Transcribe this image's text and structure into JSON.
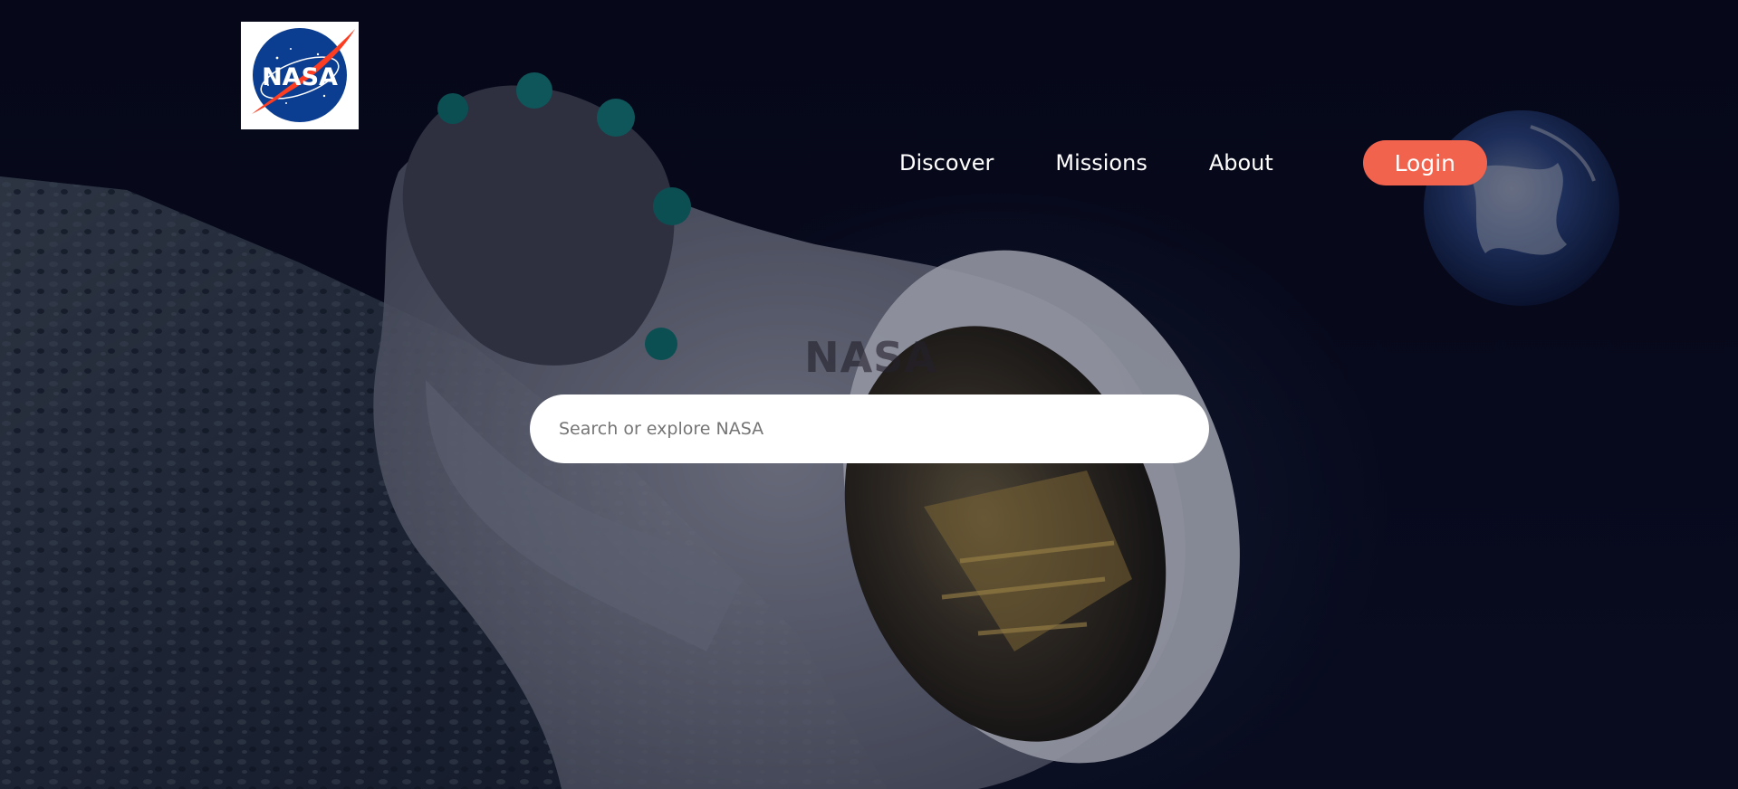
{
  "header": {
    "logo": {
      "icon": "nasa-meatball-logo",
      "text": "NASA"
    }
  },
  "nav": {
    "items": [
      {
        "label": "Discover"
      },
      {
        "label": "Missions"
      },
      {
        "label": "About"
      }
    ],
    "login_label": "Login"
  },
  "hero": {
    "heading": "NASA",
    "background": "astronaut-on-moon-with-earth-image",
    "search": {
      "placeholder": "Search or explore NASA",
      "value": ""
    }
  },
  "colors": {
    "background": "#070a1c",
    "accent": "#f2634d",
    "nav_text": "#ffffff",
    "nasa_blue": "#0b3d91",
    "nasa_red": "#fc3d21"
  }
}
